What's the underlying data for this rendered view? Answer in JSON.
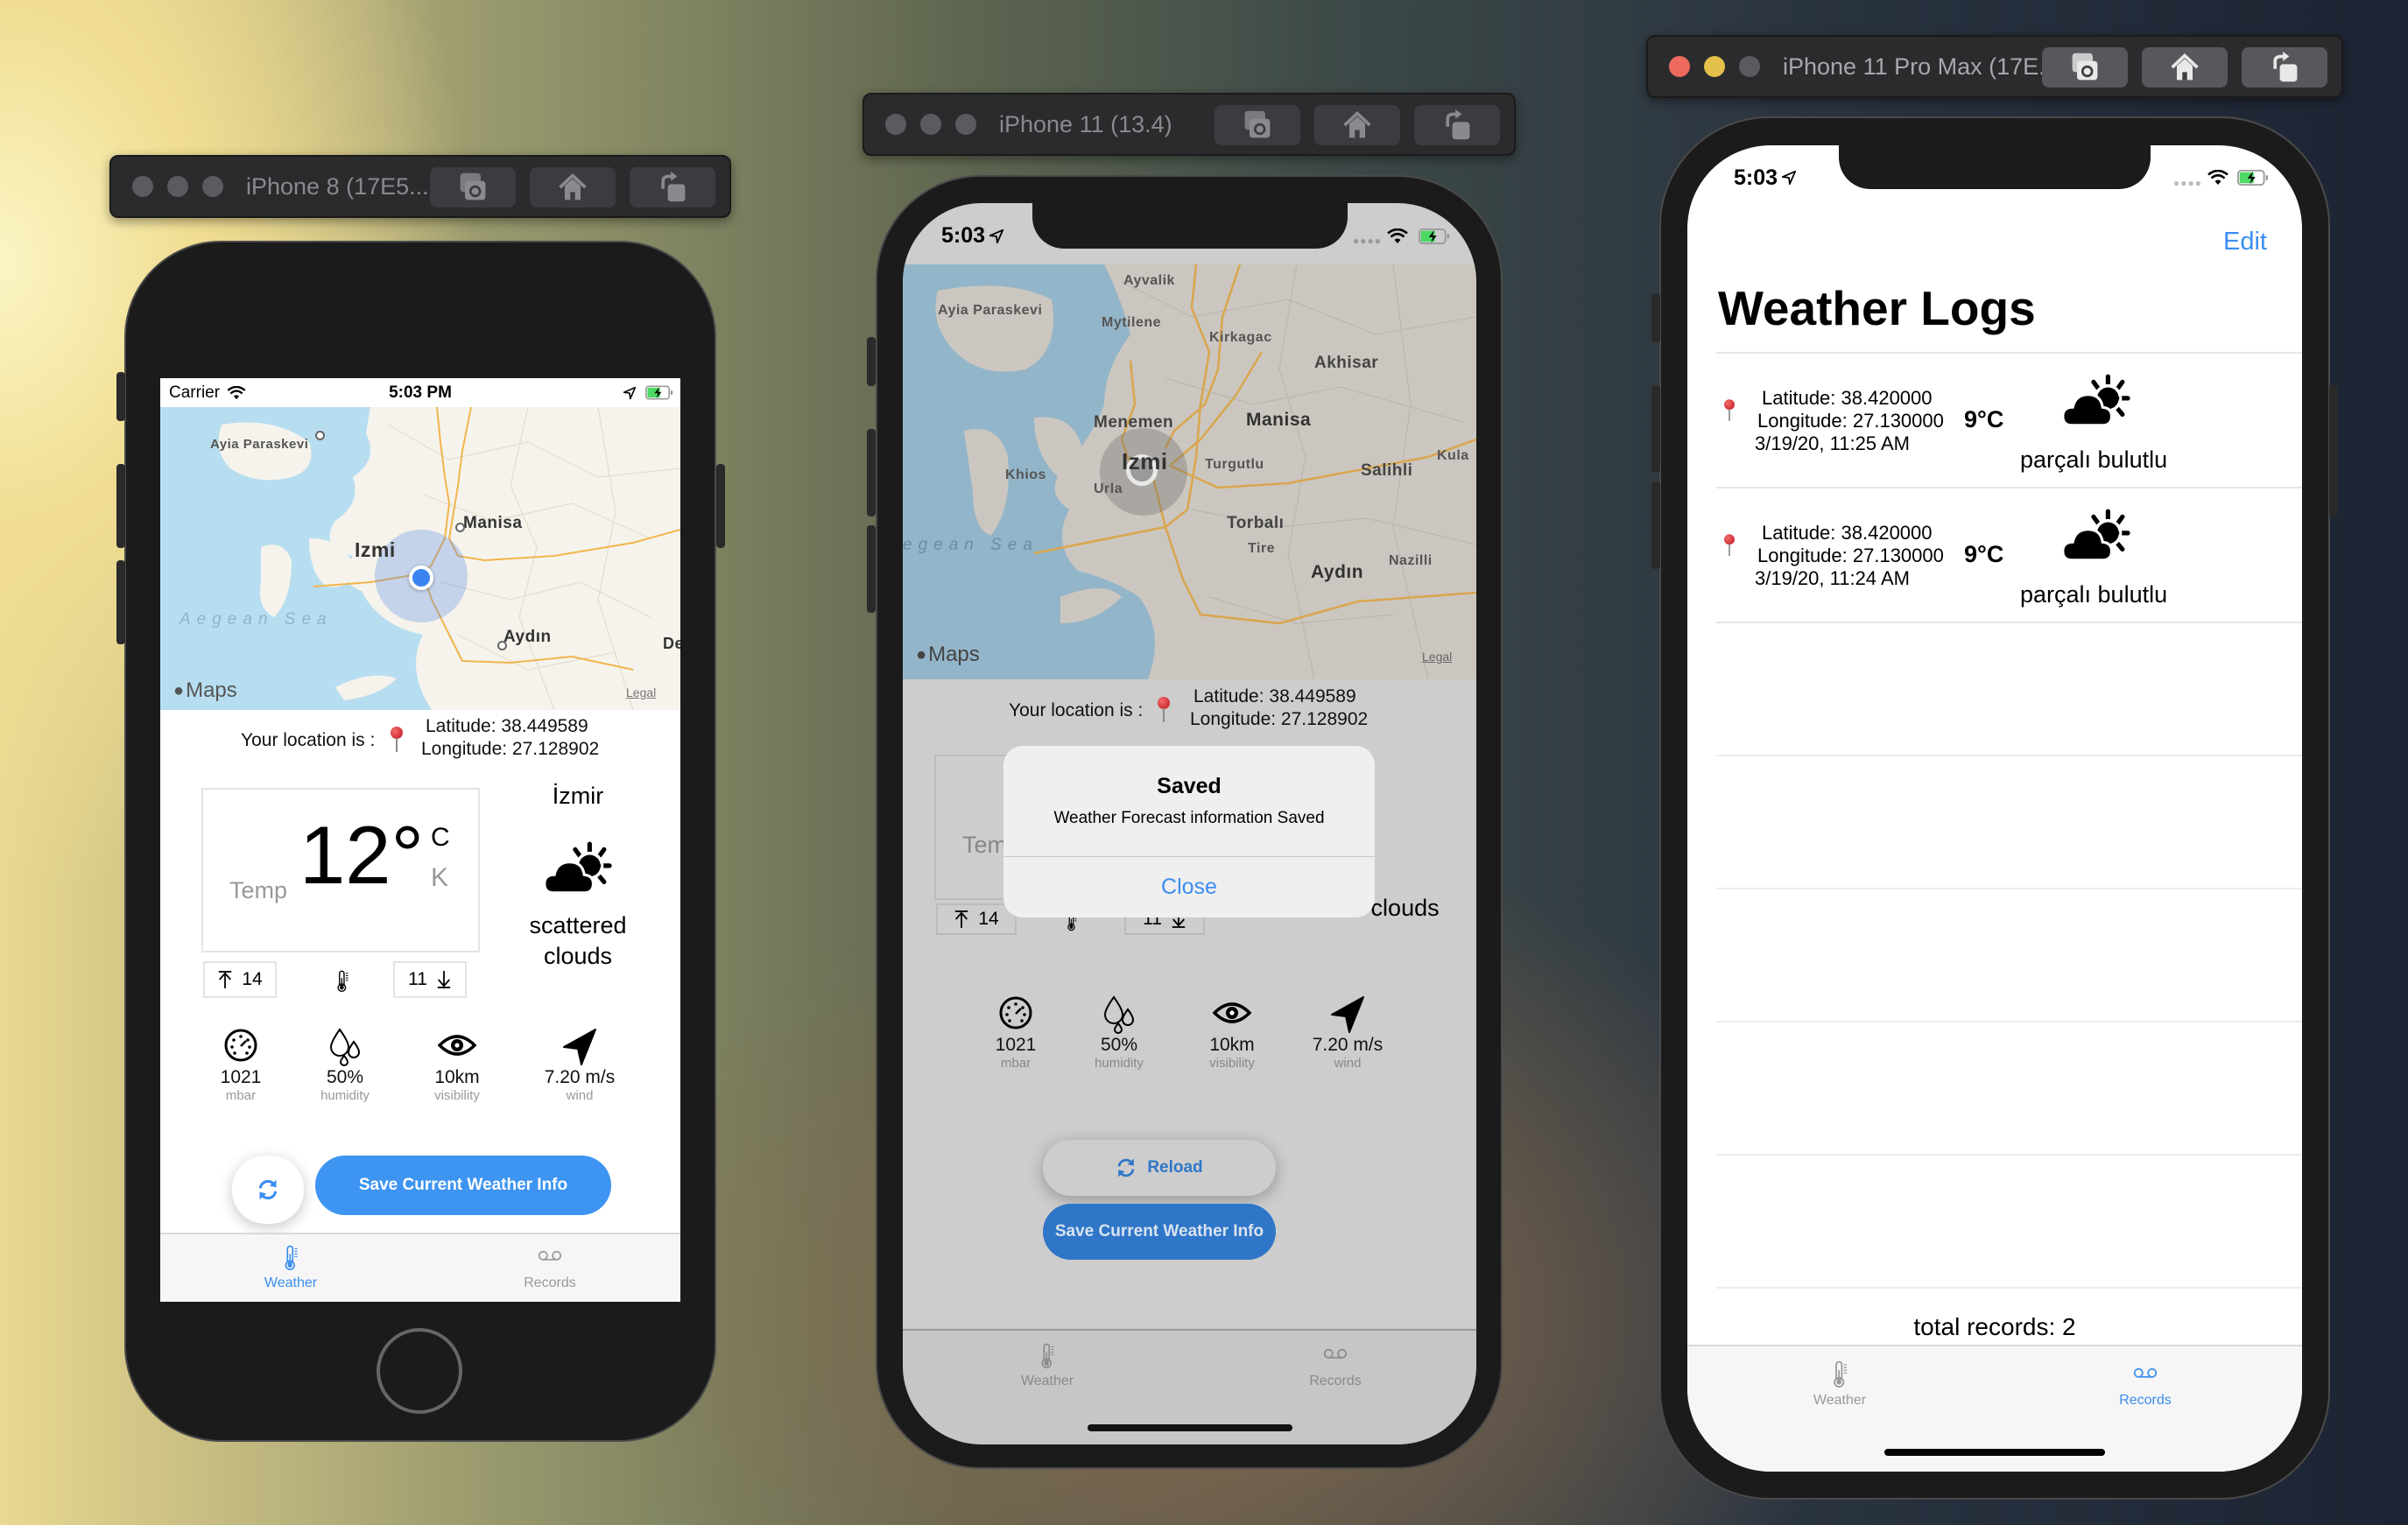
{
  "simulators": [
    {
      "title": "iPhone 8 (17E5...",
      "active": false
    },
    {
      "title": "iPhone 11 (13.4)",
      "active": false
    },
    {
      "title": "iPhone 11 Pro Max (17E...",
      "active": true
    }
  ],
  "toolbar_buttons": [
    "screenshot",
    "home",
    "rotate"
  ],
  "status": {
    "carrier": "Carrier",
    "time_long": "5:03 PM",
    "time_short": "5:03"
  },
  "map": {
    "attribution": "Maps",
    "legal": "Legal",
    "labels": {
      "ayia_paraskevi": "Ayia Paraskevi",
      "izmir": "Izmi",
      "manisa": "Manisa",
      "aegean_sea": "Aegean Sea",
      "aydin": "Aydın",
      "de": "De",
      "ayvalik": "Ayvalik",
      "mytilene": "Mytilene",
      "kirkagac": "Kirkagac",
      "akhisar": "Akhisar",
      "menemen": "Menemen",
      "turgutlu": "Turgutlu",
      "salihli": "Salihli",
      "kula": "Kula",
      "khios": "Khios",
      "urla": "Urla",
      "torbali": "Torbalı",
      "tire": "Tire",
      "nazilli": "Nazilli",
      "aegean_sea_partial": "egean Sea"
    }
  },
  "weather": {
    "location_label": "Your location is :",
    "latitude": "Latitude: 38.449589",
    "longitude": "Longitude: 27.128902",
    "temp_label": "Temp",
    "temp_value": "12°",
    "unit_c": "C",
    "unit_k": "K",
    "max_temp": "14",
    "min_temp": "11",
    "city": "İzmir",
    "description": "scattered clouds",
    "description_line1": "scattered",
    "description_line2": "clouds",
    "metrics": [
      {
        "icon": "pressure-gauge-icon",
        "value": "1021",
        "label": "mbar"
      },
      {
        "icon": "humidity-drops-icon",
        "value": "50%",
        "label": "humidity"
      },
      {
        "icon": "visibility-eye-icon",
        "value": "10km",
        "label": "visibility"
      },
      {
        "icon": "wind-arrow-icon",
        "value": "7.20 m/s",
        "label": "wind"
      }
    ],
    "save_button": "Save Current Weather Info",
    "reload_button": "Reload"
  },
  "alert": {
    "title": "Saved",
    "message": "Weather Forecast information Saved",
    "close": "Close"
  },
  "tabs": {
    "weather": "Weather",
    "records": "Records"
  },
  "records_screen": {
    "edit": "Edit",
    "title": "Weather Logs",
    "records": [
      {
        "latitude": "Latitude: 38.420000",
        "longitude": "Longitude: 27.130000",
        "date": "3/19/20, 11:25 AM",
        "temp": "9°C",
        "description": "parçalı bulutlu"
      },
      {
        "latitude": "Latitude: 38.420000",
        "longitude": "Longitude: 27.130000",
        "date": "3/19/20, 11:24 AM",
        "temp": "9°C",
        "description": "parçalı bulutlu"
      }
    ],
    "total": "total records: 2"
  },
  "colors": {
    "accent": "#3b8ef0",
    "pin_red": "#d0202a",
    "sea": "#b7def0",
    "land": "#f6f3ec",
    "road": "#f2b54b"
  }
}
